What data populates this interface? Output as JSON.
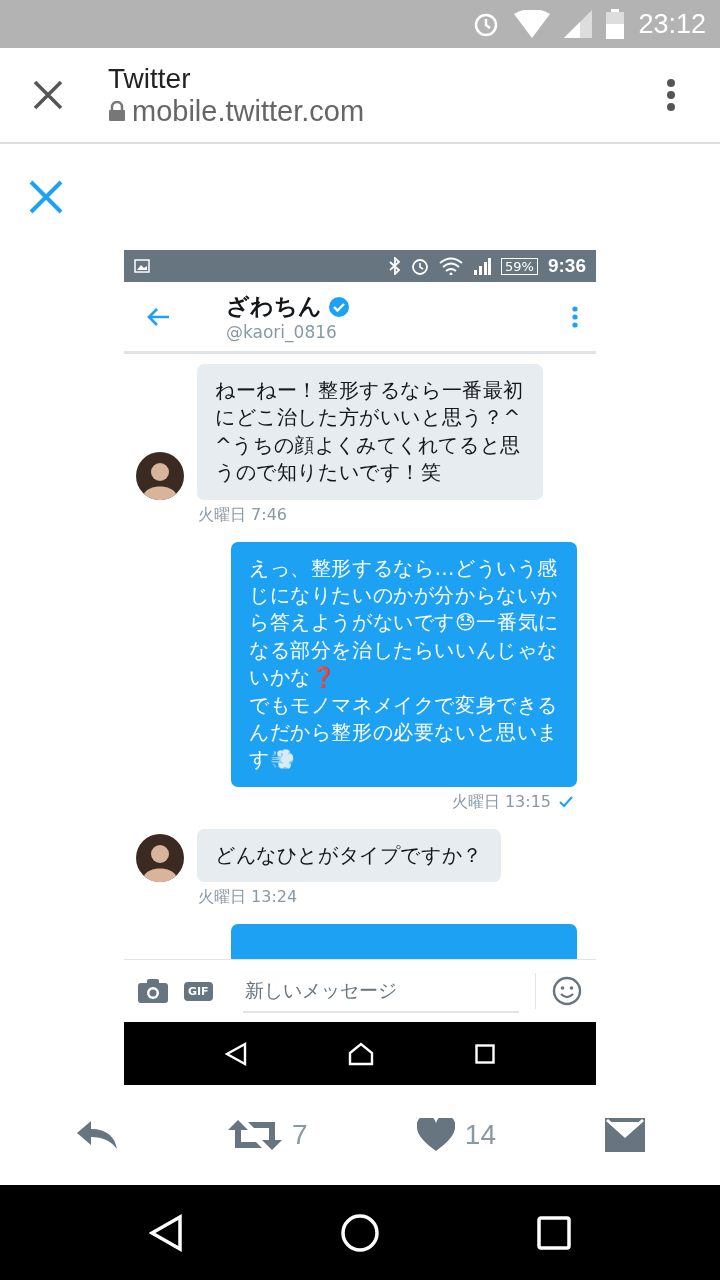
{
  "status_bar": {
    "time": "23:12"
  },
  "browser": {
    "title": "Twitter",
    "url": "mobile.twitter.com"
  },
  "embedded_screenshot": {
    "status_bar": {
      "battery": "59%",
      "time": "9:36"
    },
    "conversation": {
      "name": "ざわちん",
      "verified": true,
      "handle": "@kaori_0816"
    },
    "messages": [
      {
        "kind": "received",
        "text": "ねーねー！整形するなら一番最初にどこ治した方がいいと思う？^^うちの顔よくみてくれてると思うので知りたいです！笑",
        "day": "火曜日",
        "time": "7:46"
      },
      {
        "kind": "sent",
        "text": "えっ、整形するなら…どういう感じになりたいのかが分からないから答えようがないです😓一番気になる部分を治したらいいんじゃないかな❓\nでもモノマネメイクで変身できるんだから整形の必要ないと思います💨",
        "day": "火曜日",
        "time": "13:15",
        "read": true
      },
      {
        "kind": "received",
        "text": "どんなひとがタイプですか？",
        "day": "火曜日",
        "time": "13:24"
      },
      {
        "kind": "sent"
      }
    ],
    "composer": {
      "gif_label": "GIF",
      "placeholder": "新しいメッセージ"
    }
  },
  "actions": {
    "retweets": "7",
    "likes": "14"
  }
}
